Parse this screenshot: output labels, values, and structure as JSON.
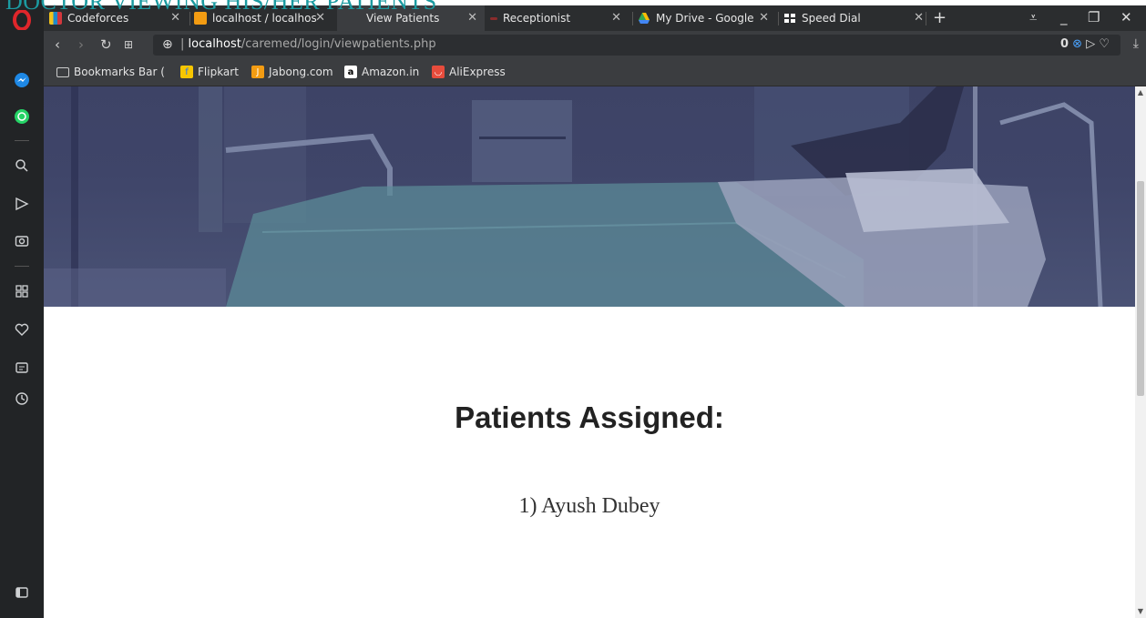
{
  "caption": "DOCTOR VIEWING HIS/HER PATIENTS",
  "tabs": [
    {
      "title": "Codeforces",
      "favicon_color": "#1f8acb",
      "active": false
    },
    {
      "title": "localhost / localhos",
      "favicon_color": "#f39c12",
      "active": false
    },
    {
      "title": "View Patients",
      "favicon_color": "#c0392b",
      "active": true
    },
    {
      "title": "Receptionist",
      "favicon_color": "#c0392b",
      "active": false
    },
    {
      "title": "My Drive - Google",
      "favicon_color": "#4285f4",
      "active": false
    },
    {
      "title": "Speed Dial",
      "favicon_color": "#ffffff",
      "active": false
    }
  ],
  "address": {
    "host": "localhost",
    "path": "/caremed/login/viewpatients.php",
    "badge_count": "0"
  },
  "bookmarks": [
    {
      "label": "Bookmarks Bar (",
      "icon": "folder-icon"
    },
    {
      "label": "Flipkart",
      "icon": "flipkart-icon",
      "color": "#f7c600"
    },
    {
      "label": "Jabong.com",
      "icon": "jabong-icon",
      "color": "#f39c12"
    },
    {
      "label": "Amazon.in",
      "icon": "amazon-icon",
      "color": "#ffffff"
    },
    {
      "label": "AliExpress",
      "icon": "aliexpress-icon",
      "color": "#e74c3c"
    }
  ],
  "page": {
    "heading": "Patients Assigned:",
    "patients": [
      "1) Ayush Dubey"
    ]
  }
}
